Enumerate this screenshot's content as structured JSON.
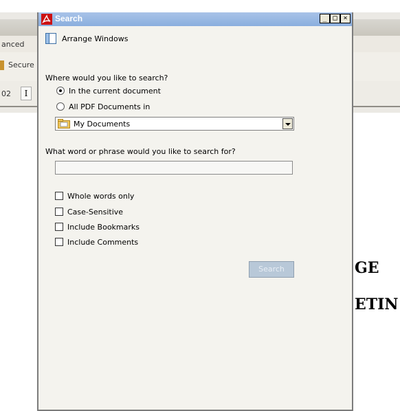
{
  "background": {
    "tab_fragment": "anced",
    "secure_fragment": "Secure",
    "page_fragment": "02",
    "doc_line1": "GE",
    "doc_line2": "ETIN"
  },
  "dialog": {
    "title": "Search",
    "arrange_label": "Arrange Windows",
    "where_question": "Where would you like to search?",
    "radio_current": "In the current document",
    "radio_all": "All PDF Documents in",
    "location_value": "My Documents",
    "phrase_question": "What word or phrase would you like to search for?",
    "phrase_value": "",
    "options": [
      {
        "label": "Whole words only",
        "checked": false
      },
      {
        "label": "Case-Sensitive",
        "checked": false
      },
      {
        "label": "Include Bookmarks",
        "checked": false
      },
      {
        "label": "Include Comments",
        "checked": false
      }
    ],
    "search_button": "Search",
    "window_buttons": {
      "minimize": "_",
      "maximize": "□",
      "close": "×"
    }
  },
  "colors": {
    "titlebar": "#8aaede",
    "dialog_bg": "#f4f3ee",
    "disabled_button": "#b8c8d8"
  }
}
